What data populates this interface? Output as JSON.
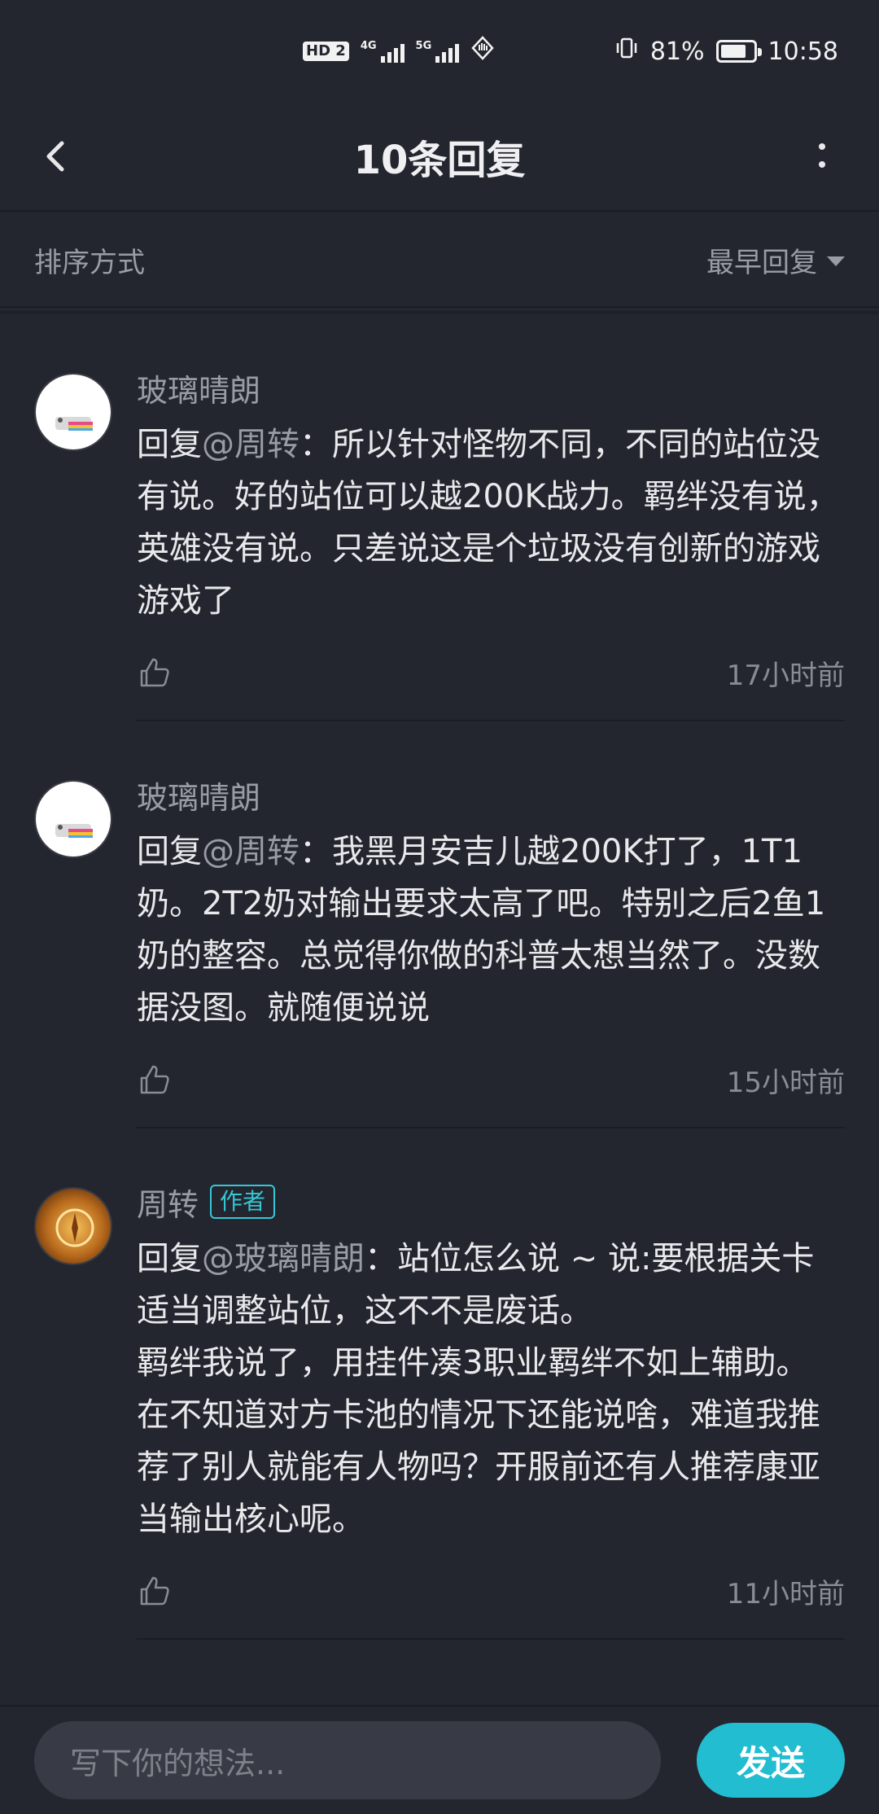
{
  "status_bar": {
    "hd_label": "HD",
    "hd_sim": "2",
    "net1_gen": "4G",
    "net2_gen": "5G",
    "battery_percent": "81%",
    "battery_level": 0.81,
    "time": "10:58"
  },
  "header": {
    "title": "10条回复"
  },
  "sort": {
    "label": "排序方式",
    "selected": "最早回复"
  },
  "comments": [
    {
      "username": "玻璃晴朗",
      "is_author": false,
      "reply_prefix": "回复",
      "reply_to": "@周转",
      "lines": [
        "：所以针对怪物不同，不同的站位没有说。好的站位可以越200K战力。羁绊没有说，英雄没有说。只差说这是个垃圾没有创新的游戏游戏了"
      ],
      "time": "17小时前"
    },
    {
      "username": "玻璃晴朗",
      "is_author": false,
      "reply_prefix": "回复",
      "reply_to": "@周转",
      "lines": [
        "：我黑月安吉儿越200K打了，1T1奶。2T2奶对输出要求太高了吧。特别之后2鱼1奶的整容。总觉得你做的科普太想当然了。没数据没图。就随便说说"
      ],
      "time": "15小时前"
    },
    {
      "username": "周转",
      "is_author": true,
      "author_tag": "作者",
      "reply_prefix": "回复",
      "reply_to": "@玻璃晴朗",
      "lines": [
        "：站位怎么说 ~ 说:要根据关卡适当调整站位，这不不是废话。",
        "羁绊我说了，用挂件凑3职业羁绊不如上辅助。",
        "在不知道对方卡池的情况下还能说啥，难道我推荐了别人就能有人物吗？开服前还有人推荐康亚当输出核心呢。"
      ],
      "time": "11小时前"
    }
  ],
  "composer": {
    "placeholder": "写下你的想法...",
    "send_label": "发送"
  },
  "colors": {
    "background": "#24262f",
    "accent": "#22bdd0",
    "author_tag": "#35c7d6",
    "muted_text": "#9a9ca4"
  }
}
